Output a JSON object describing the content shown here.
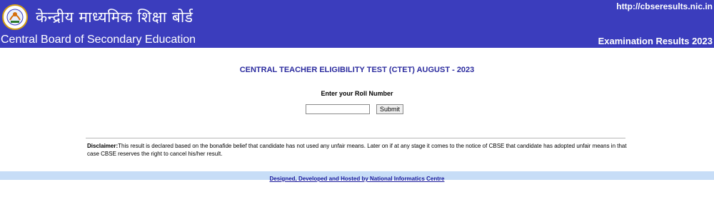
{
  "header": {
    "hindi_title": "केन्द्रीय माध्यमिक शिक्षा बोर्ड",
    "board_name": "Central Board of Secondary Education",
    "site_url": "http://cbseresults.nic.in",
    "page_title": "Examination Results 2023",
    "logo_icon": "cbse-emblem-icon"
  },
  "main": {
    "exam_title": "CENTRAL TEACHER ELIGIBILITY TEST (CTET) AUGUST - 2023",
    "roll_label": "Enter your Roll Number",
    "roll_input_value": "",
    "submit_label": "Submit"
  },
  "disclaimer": {
    "label": "Disclaimer:",
    "text": "This result is declared based on the bonafide belief that candidate has not used any unfair means. Later on if at any stage it comes to the notice of CBSE that candidate has adopted unfair means in that case CBSE reserves the right to cancel his/her result."
  },
  "footer": {
    "credit": "Designed, Developed and Hosted by National Informatics Centre"
  },
  "colors": {
    "header_bg": "#3b3dbd",
    "title_blue": "#2a2a9e",
    "footer_bg": "#c7ddf7"
  }
}
